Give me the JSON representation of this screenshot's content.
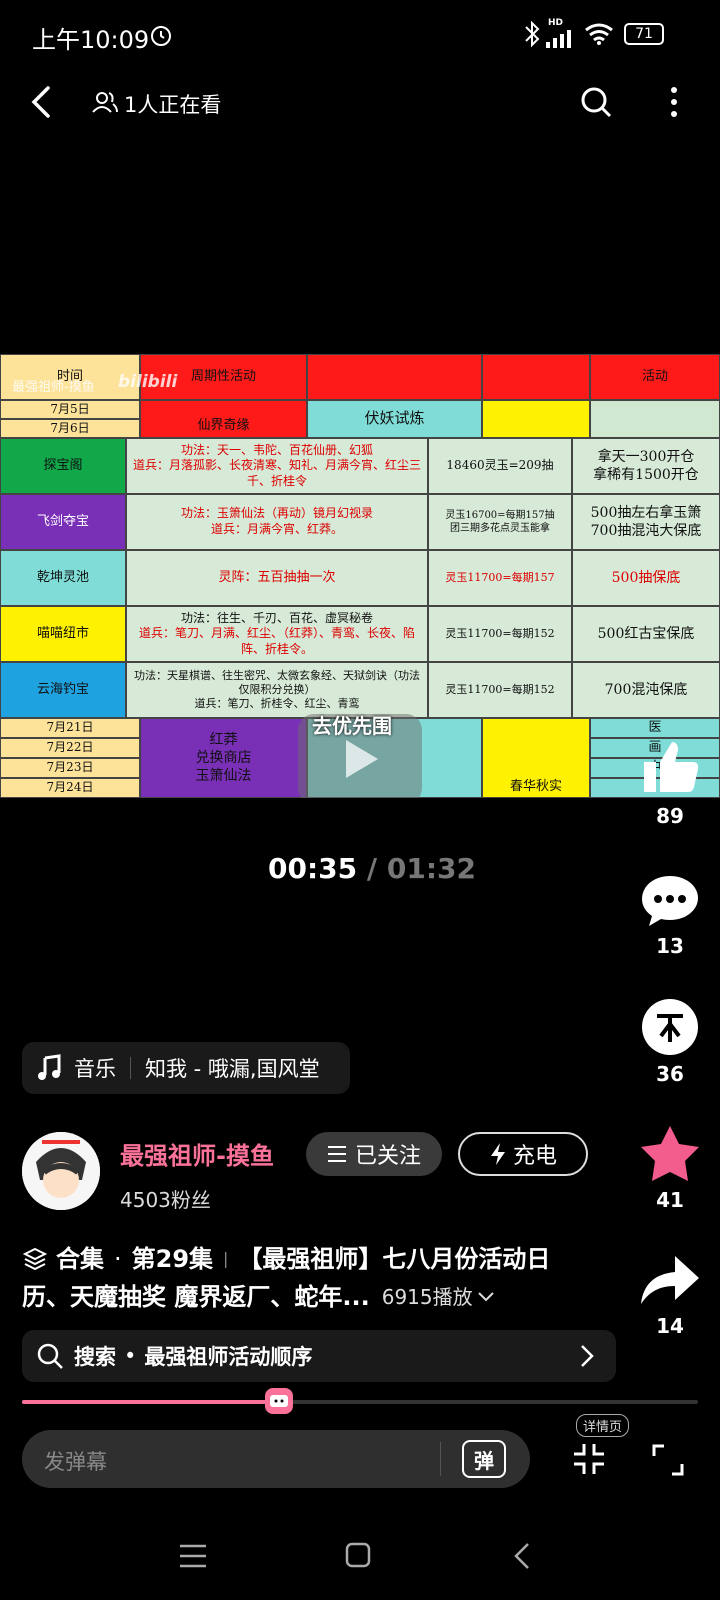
{
  "status": {
    "time": "上午10:09",
    "battery": "71",
    "network": "HD"
  },
  "header": {
    "watching": "1人正在看"
  },
  "video_table": {
    "watermark": "最强祖师-摸鱼",
    "brand": "bilibili",
    "head": {
      "time": "时间",
      "periodic": "周期性活动",
      "activity": "活动"
    },
    "top_dates": [
      "7月5日",
      "7月6日"
    ],
    "top_events": {
      "a": "仙界奇缘",
      "b": "伏妖试炼"
    },
    "rows": [
      {
        "name": "探宝阁",
        "desc1": "功法：天一、韦陀、百花仙册、幻狐",
        "desc2": "道兵：月落孤影、长夜清寒、知礼、月满今宵、红尘三千、折桂令",
        "cost": "18460灵玉=209抽",
        "note": "拿天一300开仓\n拿稀有1500开仓"
      },
      {
        "name": "飞剑夺宝",
        "desc1": "功法：玉箫仙法（再动）镜月幻视录",
        "desc2": "道兵：月满今宵、红莽。",
        "cost": "灵玉16700=每期157抽\n团三期多花点灵玉能拿",
        "note": "500抽左右拿玉箫\n700抽混沌大保底"
      },
      {
        "name": "乾坤灵池",
        "desc1": "灵阵：五百抽抽一次",
        "desc2": "",
        "cost": "灵玉11700=每期157",
        "note": "500抽保底"
      },
      {
        "name": "喵喵纽市",
        "desc1": "功法：往生、千刃、百花、虚冥秘卷",
        "desc2": "道兵：笔刀、月满、红尘、（红莽）、青鸾、长夜、陷阵、折桂令。",
        "cost": "灵玉11700=每期152",
        "note": "500红古宝保底"
      },
      {
        "name": "云海钓宝",
        "desc1": "功法：天星棋谱、往生密咒、太微玄象经、天狱剑诀（功法仅限积分兑换）",
        "desc2": "道兵：笔刀、折桂令、红尘、青鸾",
        "cost": "灵玉11700=每期152",
        "note": "700混沌保底"
      }
    ],
    "bottom_dates": [
      "7月21日",
      "7月22日",
      "7月23日",
      "7月24日"
    ],
    "bottom_purple": "红莽\n兑换商店\n玉箫仙法",
    "bottom_yellow": "春华秋实",
    "bottom_right": [
      "医",
      "画",
      "中",
      ""
    ],
    "overlay": "去优先围"
  },
  "player": {
    "current": "00:35",
    "sep": "/",
    "total": "01:32",
    "progress": 0.38
  },
  "right_actions": {
    "like": "89",
    "comment": "13",
    "coin": "36",
    "fav": "41",
    "share": "14"
  },
  "music": {
    "label": "音乐",
    "song": "知我 - 哦漏,国风堂"
  },
  "uploader": {
    "name": "最强祖师-摸鱼",
    "fans": "4503粉丝",
    "follow": "已关注",
    "charge": "充电"
  },
  "title": {
    "collection": "合集",
    "episode": "第29集",
    "text1": "【最强祖师】七八月份活动日",
    "text2": "历、天魔抽奖 魔界返厂、蛇年...",
    "plays": "6915播放"
  },
  "search": {
    "prefix": "搜索",
    "query": "最强祖师活动顺序"
  },
  "danmaku": {
    "placeholder": "发弹幕",
    "btn": "弹",
    "detail": "详情页"
  },
  "colors": {
    "accent": "#fb7299",
    "star": "#f25d8e"
  }
}
